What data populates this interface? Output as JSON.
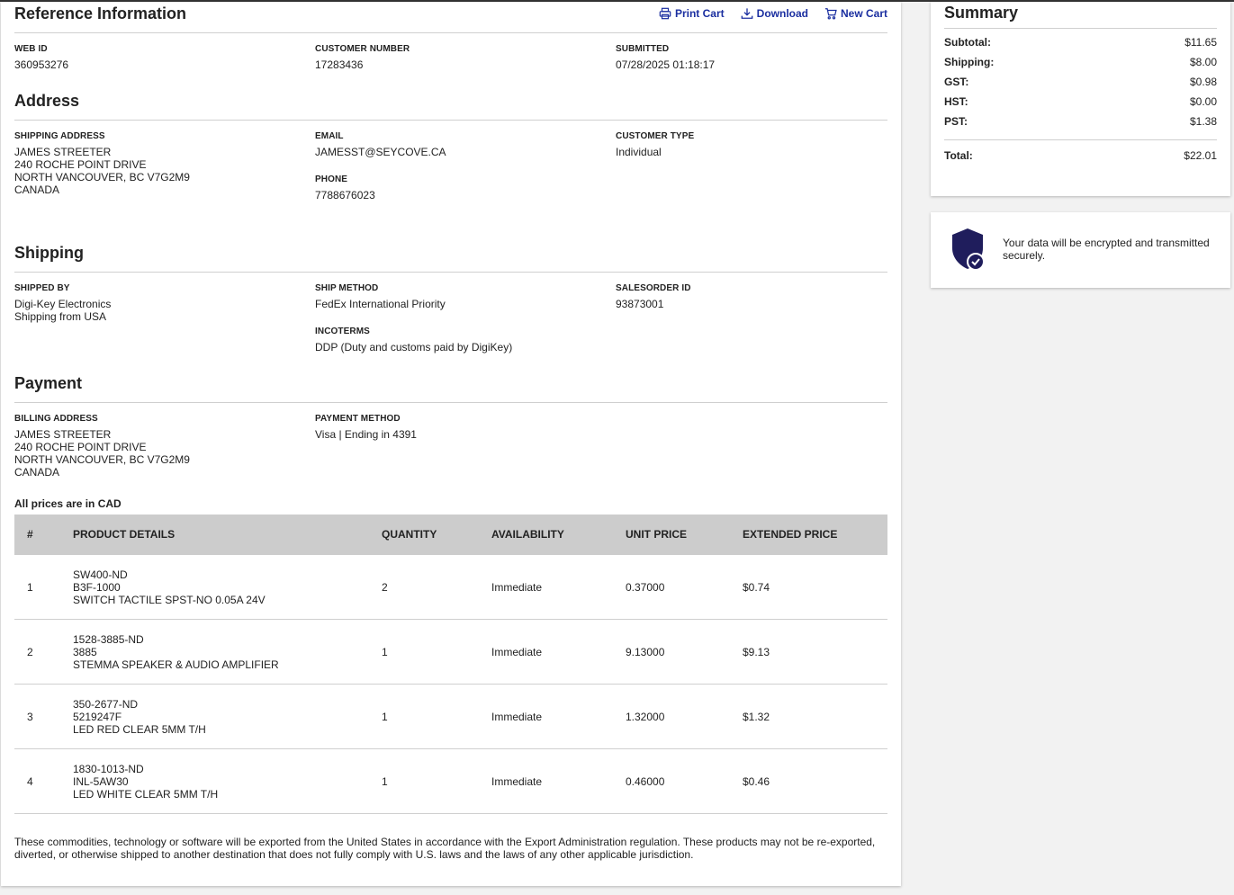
{
  "reference": {
    "title": "Reference Information",
    "actions": {
      "print": "Print Cart",
      "download": "Download",
      "new_cart": "New Cart"
    },
    "web_id_label": "WEB ID",
    "web_id": "360953276",
    "customer_number_label": "CUSTOMER NUMBER",
    "customer_number": "17283436",
    "submitted_label": "SUBMITTED",
    "submitted": "07/28/2025 01:18:17"
  },
  "address": {
    "title": "Address",
    "shipping_label": "SHIPPING ADDRESS",
    "shipping_lines": [
      "JAMES STREETER",
      "240 ROCHE POINT DRIVE",
      "NORTH VANCOUVER, BC V7G2M9",
      "CANADA"
    ],
    "email_label": "EMAIL",
    "email": "JAMESST@SEYCOVE.CA",
    "phone_label": "PHONE",
    "phone": "7788676023",
    "customer_type_label": "CUSTOMER TYPE",
    "customer_type": "Individual"
  },
  "shipping": {
    "title": "Shipping",
    "shipped_by_label": "SHIPPED BY",
    "shipped_by_lines": [
      "Digi-Key Electronics",
      "Shipping from USA"
    ],
    "ship_method_label": "SHIP METHOD",
    "ship_method": "FedEx International Priority",
    "incoterms_label": "INCOTERMS",
    "incoterms": "DDP (Duty and customs paid by DigiKey)",
    "salesorder_label": "SALESORDER ID",
    "salesorder": "93873001"
  },
  "payment": {
    "title": "Payment",
    "billing_label": "BILLING ADDRESS",
    "billing_lines": [
      "JAMES STREETER",
      "240 ROCHE POINT DRIVE",
      "NORTH VANCOUVER, BC V7G2M9",
      "CANADA"
    ],
    "method_label": "PAYMENT METHOD",
    "method": "Visa | Ending in 4391"
  },
  "prices_note": "All prices are in CAD",
  "table": {
    "headers": [
      "#",
      "PRODUCT DETAILS",
      "QUANTITY",
      "AVAILABILITY",
      "UNIT PRICE",
      "EXTENDED PRICE"
    ],
    "rows": [
      {
        "num": "1",
        "part": "SW400-ND",
        "mfr": "B3F-1000",
        "desc": "SWITCH TACTILE SPST-NO 0.05A 24V",
        "qty": "2",
        "availability": "Immediate",
        "unit_price": "0.37000",
        "extended_price": "$0.74"
      },
      {
        "num": "2",
        "part": "1528-3885-ND",
        "mfr": "3885",
        "desc": "STEMMA SPEAKER & AUDIO AMPLIFIER",
        "qty": "1",
        "availability": "Immediate",
        "unit_price": "9.13000",
        "extended_price": "$9.13"
      },
      {
        "num": "3",
        "part": "350-2677-ND",
        "mfr": "5219247F",
        "desc": "LED RED CLEAR 5MM T/H",
        "qty": "1",
        "availability": "Immediate",
        "unit_price": "1.32000",
        "extended_price": "$1.32"
      },
      {
        "num": "4",
        "part": "1830-1013-ND",
        "mfr": "INL-5AW30",
        "desc": "LED WHITE CLEAR 5MM T/H",
        "qty": "1",
        "availability": "Immediate",
        "unit_price": "0.46000",
        "extended_price": "$0.46"
      }
    ]
  },
  "disclaimer": "These commodities, technology or software will be exported from the United States in accordance with the Export Administration regulation. These products may not be re-exported, diverted, or otherwise shipped to another destination that does not fully comply with U.S. laws and the laws of any other applicable jurisdiction.",
  "summary": {
    "title": "Summary",
    "subtotal_label": "Subtotal:",
    "subtotal": "$11.65",
    "shipping_label": "Shipping:",
    "shipping": "$8.00",
    "gst_label": "GST:",
    "gst": "$0.98",
    "hst_label": "HST:",
    "hst": "$0.00",
    "pst_label": "PST:",
    "pst": "$1.38",
    "total_label": "Total:",
    "total": "$22.01"
  },
  "secure": {
    "text": "Your data will be encrypted and transmitted securely."
  },
  "colors": {
    "link": "#1b2fa0",
    "shield": "#1f1d5c",
    "table_header_bg": "#cccccc"
  },
  "icons": {
    "print": "printer-icon",
    "download": "download-icon",
    "new_cart": "cart-icon",
    "secure": "shield-check-icon"
  }
}
